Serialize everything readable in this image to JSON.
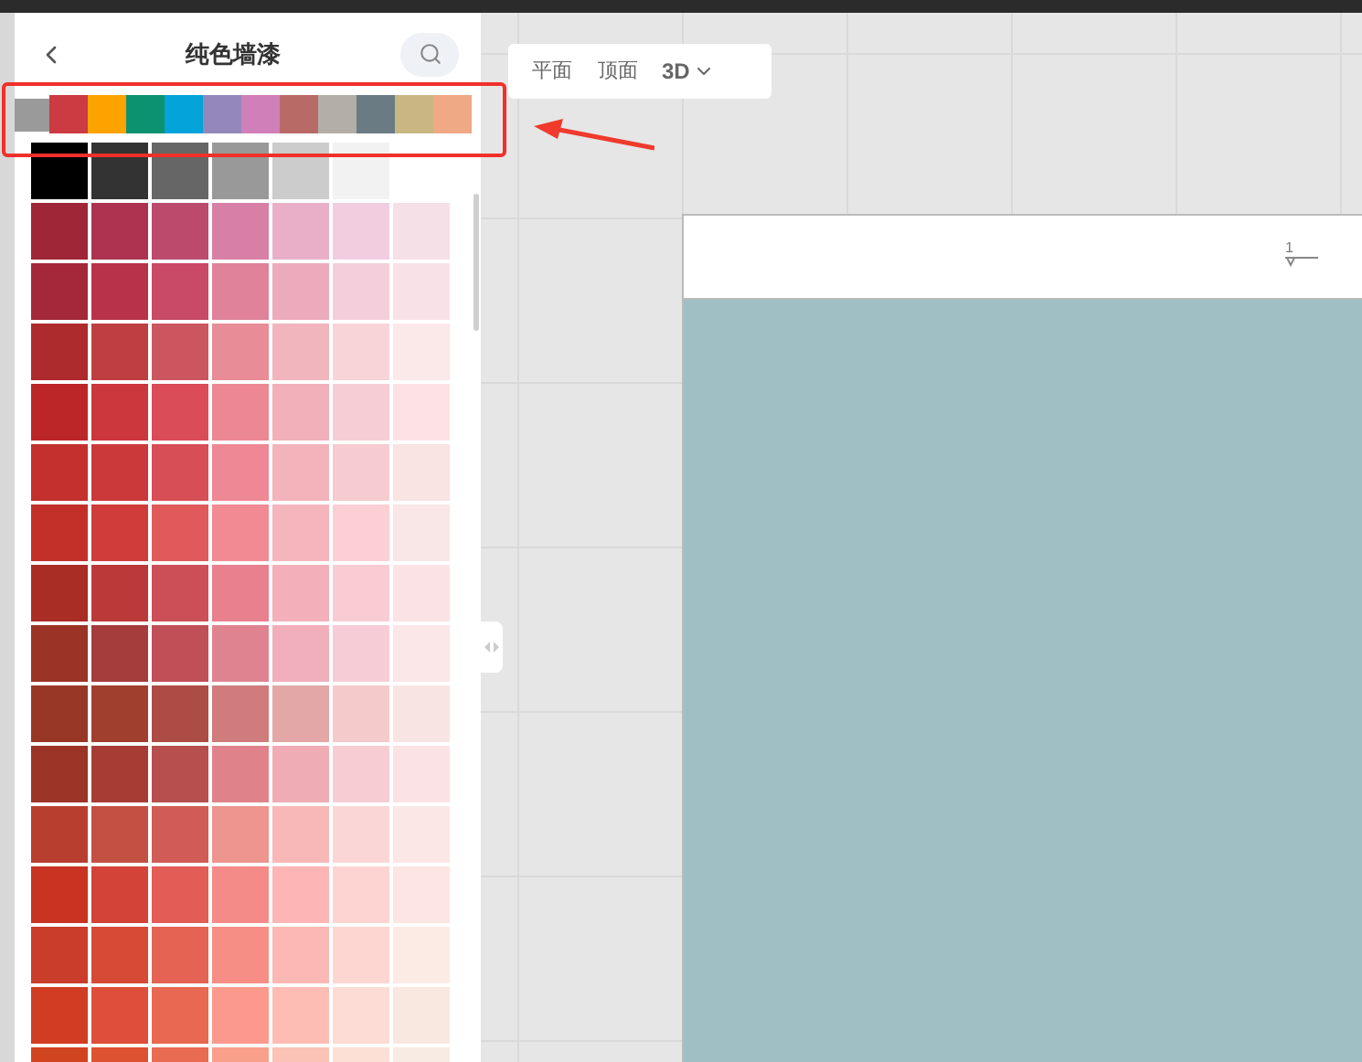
{
  "panel": {
    "title": "纯色墙漆"
  },
  "color_tabs": [
    {
      "color": "#9a9a9a"
    },
    {
      "color": "#cc3a42"
    },
    {
      "color": "#fda300"
    },
    {
      "color": "#0d9270"
    },
    {
      "color": "#04a3da"
    },
    {
      "color": "#9487bc"
    },
    {
      "color": "#d17fb8"
    },
    {
      "color": "#b86b66"
    },
    {
      "color": "#b3aea8"
    },
    {
      "color": "#6b7b84"
    },
    {
      "color": "#c9b783"
    },
    {
      "color": "#f0a985"
    }
  ],
  "palette": [
    {
      "swatches": [
        {
          "color": "#000000"
        },
        {
          "color": "#333333"
        },
        {
          "color": "#666666"
        },
        {
          "color": "#999999"
        },
        {
          "color": "#cccccc"
        },
        {
          "color": "#f2f2f2"
        }
      ]
    },
    {
      "swatches": [
        {
          "color": "#9f2637"
        },
        {
          "color": "#ad3350"
        },
        {
          "color": "#bb4a6c"
        },
        {
          "color": "#d87fa6"
        },
        {
          "color": "#e9afc8"
        },
        {
          "color": "#f2cde0"
        },
        {
          "color": "#f6e0e8"
        }
      ]
    },
    {
      "swatches": [
        {
          "color": "#a4283a"
        },
        {
          "color": "#b8334a"
        },
        {
          "color": "#c84a66"
        },
        {
          "color": "#e0829a"
        },
        {
          "color": "#ecabbd"
        },
        {
          "color": "#f4cfdb"
        },
        {
          "color": "#f8e2e8"
        }
      ]
    },
    {
      "swatches": [
        {
          "color": "#ad2a2d"
        },
        {
          "color": "#be3e42"
        },
        {
          "color": "#cc5660"
        },
        {
          "color": "#e88d97"
        },
        {
          "color": "#f1b5be"
        },
        {
          "color": "#f8d3d8"
        },
        {
          "color": "#fbe8e8"
        }
      ]
    },
    {
      "swatches": [
        {
          "color": "#bd2628"
        },
        {
          "color": "#cc363d"
        },
        {
          "color": "#d94c58"
        },
        {
          "color": "#ec8893"
        },
        {
          "color": "#f2b0ba"
        },
        {
          "color": "#f6cdd4"
        },
        {
          "color": "#fce2e4"
        }
      ]
    },
    {
      "swatches": [
        {
          "color": "#c3302e"
        },
        {
          "color": "#cc393a"
        },
        {
          "color": "#d84e56"
        },
        {
          "color": "#ee8894"
        },
        {
          "color": "#f2b3ba"
        },
        {
          "color": "#f6ccd1"
        },
        {
          "color": "#f9e3e3"
        }
      ]
    },
    {
      "swatches": [
        {
          "color": "#c3302a"
        },
        {
          "color": "#d03c3a"
        },
        {
          "color": "#e05a5c"
        },
        {
          "color": "#f28a94"
        },
        {
          "color": "#f5b5bd"
        },
        {
          "color": "#fccfd5"
        },
        {
          "color": "#f9e6e6"
        }
      ]
    },
    {
      "swatches": [
        {
          "color": "#a92d25"
        },
        {
          "color": "#bb3a39"
        },
        {
          "color": "#cc4f58"
        },
        {
          "color": "#e8808e"
        },
        {
          "color": "#f3afba"
        },
        {
          "color": "#f9ccd4"
        },
        {
          "color": "#fbe3e5"
        }
      ]
    },
    {
      "swatches": [
        {
          "color": "#9b3326"
        },
        {
          "color": "#a53d3c"
        },
        {
          "color": "#c04f58"
        },
        {
          "color": "#e08390"
        },
        {
          "color": "#f1afbb"
        },
        {
          "color": "#f6cdd6"
        },
        {
          "color": "#fbe6e8"
        }
      ]
    },
    {
      "swatches": [
        {
          "color": "#993726"
        },
        {
          "color": "#a13f2f"
        },
        {
          "color": "#ad4c44"
        },
        {
          "color": "#d07b7c"
        },
        {
          "color": "#e4a7a7"
        },
        {
          "color": "#f4caca"
        },
        {
          "color": "#f8e5e3"
        }
      ]
    },
    {
      "swatches": [
        {
          "color": "#9c3527"
        },
        {
          "color": "#a73c35"
        },
        {
          "color": "#b74f4f"
        },
        {
          "color": "#e0828a"
        },
        {
          "color": "#f0acb4"
        },
        {
          "color": "#f7cdd3"
        },
        {
          "color": "#fbe3e5"
        }
      ]
    },
    {
      "swatches": [
        {
          "color": "#b83f30"
        },
        {
          "color": "#c44f43"
        },
        {
          "color": "#d05c55"
        },
        {
          "color": "#ee958f"
        },
        {
          "color": "#f8b8b8"
        },
        {
          "color": "#fbd6d6"
        },
        {
          "color": "#fbe7e5"
        }
      ]
    },
    {
      "swatches": [
        {
          "color": "#c83322"
        },
        {
          "color": "#d34338"
        },
        {
          "color": "#e15d56"
        },
        {
          "color": "#f58b88"
        },
        {
          "color": "#fdb6b5"
        },
        {
          "color": "#fed4d2"
        },
        {
          "color": "#fce5e3"
        }
      ]
    },
    {
      "swatches": [
        {
          "color": "#c93d2a"
        },
        {
          "color": "#d64a36"
        },
        {
          "color": "#e46353"
        },
        {
          "color": "#f68e85"
        },
        {
          "color": "#fcb8b4"
        },
        {
          "color": "#fdd6d2"
        },
        {
          "color": "#fcebe5"
        }
      ]
    },
    {
      "swatches": [
        {
          "color": "#d03d22"
        },
        {
          "color": "#de4e3a"
        },
        {
          "color": "#e86852"
        },
        {
          "color": "#fb9a8c"
        },
        {
          "color": "#fdbdb4"
        },
        {
          "color": "#fcdcd4"
        },
        {
          "color": "#f8e8e0"
        }
      ]
    },
    {
      "swatches": [
        {
          "color": "#d14420"
        },
        {
          "color": "#dd5331"
        },
        {
          "color": "#e86b52"
        },
        {
          "color": "#f8a08a"
        },
        {
          "color": "#fbc3b5"
        },
        {
          "color": "#fcdfd5"
        },
        {
          "color": "#f7ebe3"
        }
      ]
    }
  ],
  "view_toolbar": {
    "buttons": [
      {
        "label": "平面",
        "kind": "plain"
      },
      {
        "label": "顶面",
        "kind": "plain"
      },
      {
        "label": "3D",
        "kind": "dropdown"
      }
    ]
  },
  "canvas": {
    "marker": "1"
  }
}
